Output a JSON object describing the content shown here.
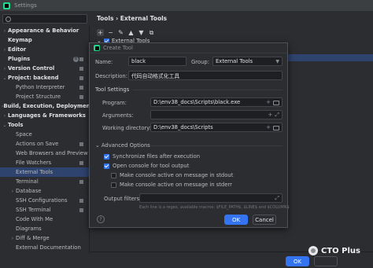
{
  "window": {
    "title": "Settings"
  },
  "breadcrumb": "Tools  ›  External Tools",
  "sidebar": {
    "items": [
      {
        "label": "Appearance & Behavior",
        "arrow": "›",
        "indent": 0,
        "bold": true,
        "marker": false
      },
      {
        "label": "Keymap",
        "arrow": "",
        "indent": 0,
        "bold": true,
        "marker": false
      },
      {
        "label": "Editor",
        "arrow": "›",
        "indent": 0,
        "bold": true,
        "marker": false
      },
      {
        "label": "Plugins",
        "arrow": "",
        "indent": 0,
        "bold": true,
        "marker": true,
        "badge": "8"
      },
      {
        "label": "Version Control",
        "arrow": "›",
        "indent": 0,
        "bold": true,
        "marker": true
      },
      {
        "label": "Project: backend",
        "arrow": "⌄",
        "indent": 0,
        "bold": true,
        "marker": true
      },
      {
        "label": "Python Interpreter",
        "arrow": "",
        "indent": 1,
        "bold": false,
        "marker": true
      },
      {
        "label": "Project Structure",
        "arrow": "",
        "indent": 1,
        "bold": false,
        "marker": true
      },
      {
        "label": "Build, Execution, Deployment",
        "arrow": "›",
        "indent": 0,
        "bold": true,
        "marker": false
      },
      {
        "label": "Languages & Frameworks",
        "arrow": "›",
        "indent": 0,
        "bold": true,
        "marker": false
      },
      {
        "label": "Tools",
        "arrow": "⌄",
        "indent": 0,
        "bold": true,
        "marker": false
      },
      {
        "label": "Space",
        "arrow": "",
        "indent": 1,
        "bold": false,
        "marker": false
      },
      {
        "label": "Actions on Save",
        "arrow": "",
        "indent": 1,
        "bold": false,
        "marker": true
      },
      {
        "label": "Web Browsers and Preview",
        "arrow": "",
        "indent": 1,
        "bold": false,
        "marker": false
      },
      {
        "label": "File Watchers",
        "arrow": "",
        "indent": 1,
        "bold": false,
        "marker": true
      },
      {
        "label": "External Tools",
        "arrow": "",
        "indent": 1,
        "bold": false,
        "marker": false,
        "selected": true
      },
      {
        "label": "Terminal",
        "arrow": "",
        "indent": 1,
        "bold": false,
        "marker": true
      },
      {
        "label": "Database",
        "arrow": "›",
        "indent": 1,
        "bold": false,
        "marker": false
      },
      {
        "label": "SSH Configurations",
        "arrow": "",
        "indent": 1,
        "bold": false,
        "marker": true
      },
      {
        "label": "SSH Terminal",
        "arrow": "",
        "indent": 1,
        "bold": false,
        "marker": true
      },
      {
        "label": "Code With Me",
        "arrow": "",
        "indent": 1,
        "bold": false,
        "marker": false
      },
      {
        "label": "Diagrams",
        "arrow": "",
        "indent": 1,
        "bold": false,
        "marker": false
      },
      {
        "label": "Diff & Merge",
        "arrow": "›",
        "indent": 1,
        "bold": false,
        "marker": false
      },
      {
        "label": "External Documentation",
        "arrow": "",
        "indent": 1,
        "bold": false,
        "marker": false
      }
    ]
  },
  "toolbar": {
    "add": "+",
    "remove": "−",
    "edit": "✎",
    "up": "▲",
    "down": "▼",
    "copy": "⧉"
  },
  "tools_list": {
    "group_label": "External Tools"
  },
  "dialog": {
    "title": "Create Tool",
    "name_label": "Name:",
    "name_value": "black",
    "group_label": "Group:",
    "group_value": "External Tools",
    "description_label": "Description:",
    "description_value": "代码自动格式化工具",
    "tool_settings_label": "Tool Settings",
    "program_label": "Program:",
    "program_value": "D:\\env38_docs\\Scripts\\black.exe",
    "arguments_label": "Arguments:",
    "arguments_value": "",
    "workdir_label": "Working directory:",
    "workdir_value": "D:\\env38_docs\\Scripts",
    "advanced_label": "Advanced Options",
    "sync_label": "Synchronize files after execution",
    "sync_checked": true,
    "console_label": "Open console for tool output",
    "console_checked": true,
    "stdout_label": "Make console active on message in stdout",
    "stdout_checked": false,
    "stderr_label": "Make console active on message in stderr",
    "stderr_checked": false,
    "output_filters_label": "Output filters:",
    "output_filters_value": "",
    "hint_text": "Each line is a regex, available macros: $FILE_PATH$, $LINE$ and $COLUMN$",
    "help": "?",
    "ok_label": "OK",
    "cancel_label": "Cancel"
  },
  "main_buttons": {
    "ok_label": "OK"
  },
  "watermark": {
    "text": "CTO Plus"
  },
  "colors": {
    "accent": "#3574f0",
    "selection": "#2e436e",
    "background": "#2b2d30",
    "field": "#1e1f22"
  }
}
